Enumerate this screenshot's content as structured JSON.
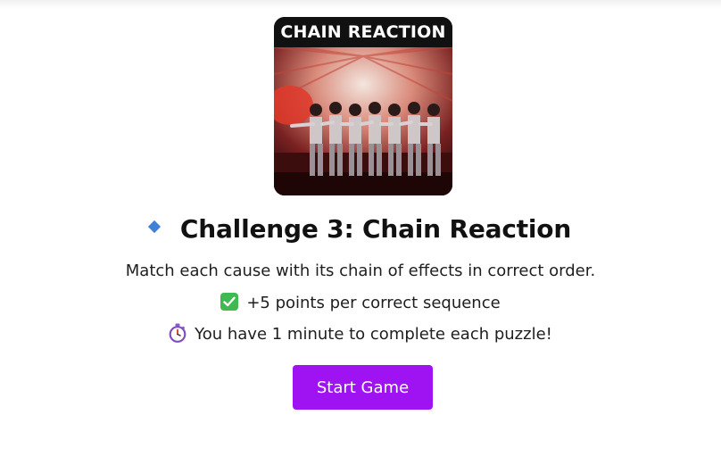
{
  "thumbnail": {
    "banner_text": "CHAIN REACTION"
  },
  "challenge": {
    "icon": "blue-diamond-icon",
    "title": "Challenge 3: Chain Reaction",
    "description": "Match each cause with its chain of effects in correct order.",
    "points_icon": "check-mark-icon",
    "points_text": "+5 points per correct sequence",
    "timer_icon": "stopwatch-icon",
    "timer_text": "You have 1 minute to complete each puzzle!"
  },
  "actions": {
    "start_label": "Start Game"
  },
  "colors": {
    "accent": "#9f12f2",
    "diamond": "#3d7fd9",
    "check": "#3fb950"
  }
}
